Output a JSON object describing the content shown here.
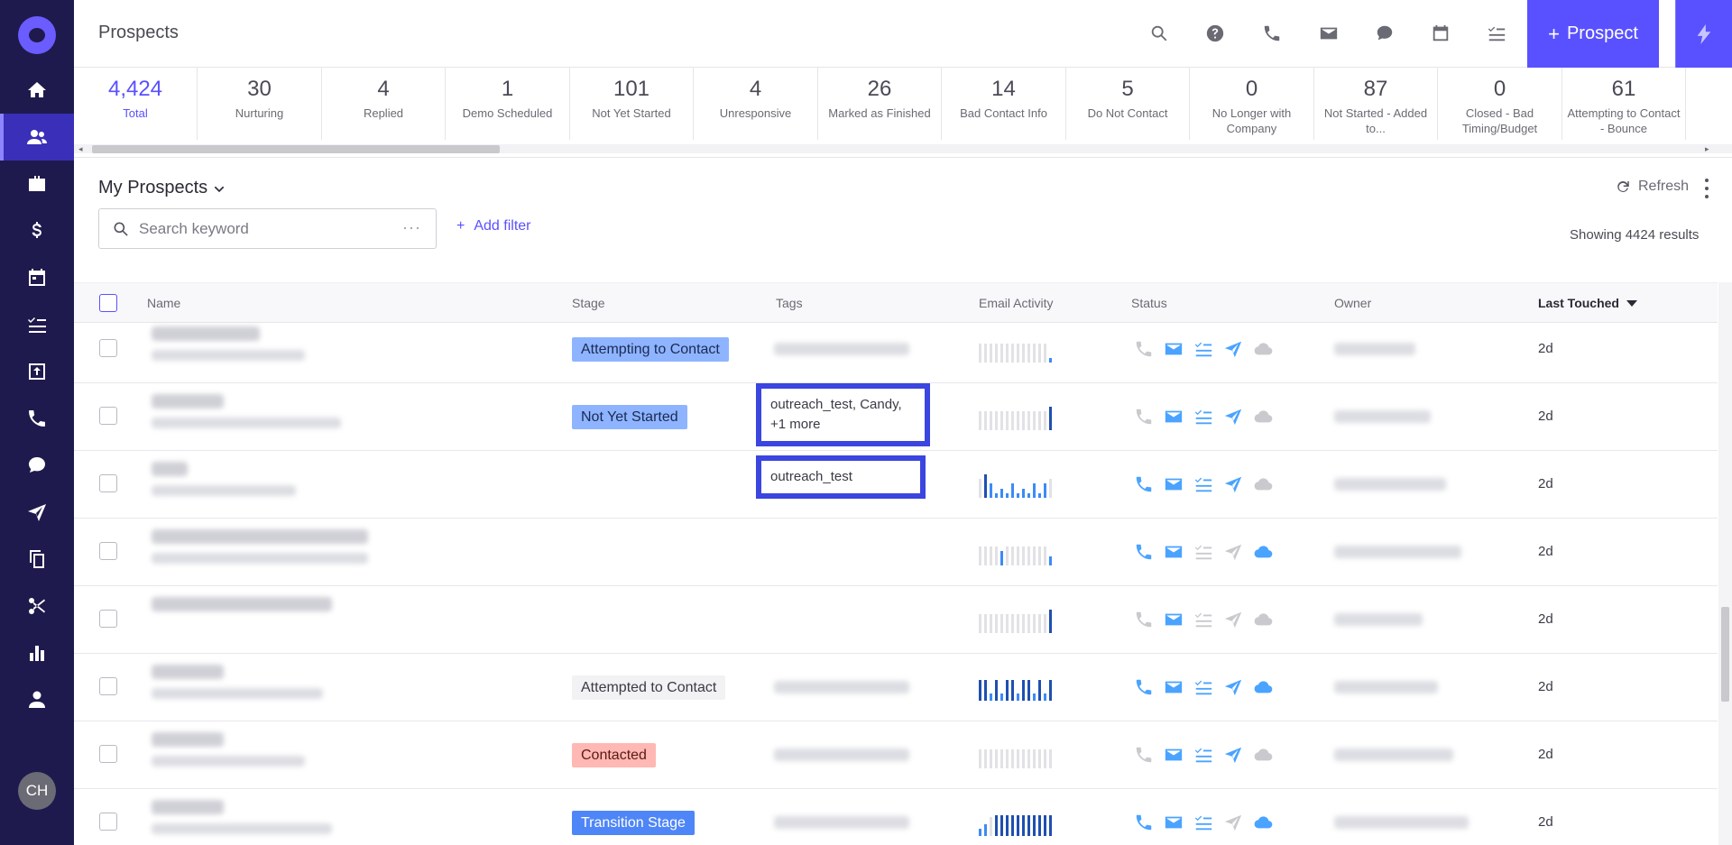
{
  "header": {
    "title": "Prospects",
    "add_label": "Prospect"
  },
  "stages": [
    {
      "count": "4,424",
      "label": "Total",
      "selected": true
    },
    {
      "count": "30",
      "label": "Nurturing"
    },
    {
      "count": "4",
      "label": "Replied"
    },
    {
      "count": "1",
      "label": "Demo Scheduled"
    },
    {
      "count": "101",
      "label": "Not Yet Started"
    },
    {
      "count": "4",
      "label": "Unresponsive"
    },
    {
      "count": "26",
      "label": "Marked as Finished"
    },
    {
      "count": "14",
      "label": "Bad Contact Info"
    },
    {
      "count": "5",
      "label": "Do Not Contact"
    },
    {
      "count": "0",
      "label": "No Longer with Company"
    },
    {
      "count": "87",
      "label": "Not Started - Added to..."
    },
    {
      "count": "0",
      "label": "Closed - Bad Timing/Budget"
    },
    {
      "count": "61",
      "label": "Attempting to Contact - Bounce"
    }
  ],
  "list": {
    "title": "My Prospects",
    "search_placeholder": "Search keyword",
    "add_filter": "Add filter",
    "refresh": "Refresh",
    "results": "Showing 4424 results"
  },
  "table": {
    "columns": {
      "name": "Name",
      "stage": "Stage",
      "tags": "Tags",
      "email_activity": "Email Activity",
      "status": "Status",
      "owner": "Owner",
      "last_touched": "Last Touched"
    },
    "rows": [
      {
        "stage": "Attempting to Contact",
        "stage_style": "blue-light",
        "tags": "",
        "tags_blur": true,
        "last_touched": "2d",
        "bars": [
          0.8,
          0.8,
          0.8,
          0.8,
          0.8,
          0.8,
          0.8,
          0.8,
          0.8,
          0.8,
          0.8,
          0.8,
          0.8,
          0.2
        ],
        "status": {
          "phone": false,
          "mail": true,
          "tasks": true,
          "send": true,
          "cloud": "gray"
        }
      },
      {
        "stage": "Not Yet Started",
        "stage_style": "blue-light",
        "tags": "outreach_test,  Candy,\n+1 more",
        "tags_boxed": true,
        "last_touched": "2d",
        "bars": [
          0.8,
          0.8,
          0.8,
          0.8,
          0.8,
          0.8,
          0.8,
          0.8,
          0.8,
          0.8,
          0.8,
          0.8,
          0.8,
          1.0
        ],
        "status": {
          "phone": false,
          "mail": true,
          "tasks": true,
          "send": true,
          "cloud": "gray"
        }
      },
      {
        "stage": "",
        "stage_style": "",
        "tags": "outreach_test",
        "tags_boxed": true,
        "last_touched": "2d",
        "bars": [
          0.8,
          1.0,
          0.6,
          0.2,
          0.4,
          0.2,
          0.6,
          0.2,
          0.4,
          0.2,
          0.6,
          0.2,
          0.6,
          0.8
        ],
        "status": {
          "phone": true,
          "mail": true,
          "tasks": true,
          "send": true,
          "cloud": "gray"
        }
      },
      {
        "stage": "",
        "stage_style": "",
        "tags": "",
        "last_touched": "2d",
        "bars": [
          0.8,
          0.8,
          0.8,
          0.8,
          0.6,
          0.8,
          0.8,
          0.8,
          0.8,
          0.8,
          0.8,
          0.8,
          0.8,
          0.4
        ],
        "status": {
          "phone": true,
          "mail": true,
          "tasks": false,
          "send": false,
          "cloud": "blue"
        }
      },
      {
        "stage": "",
        "stage_style": "",
        "tags": "",
        "last_touched": "2d",
        "bars": [
          0.8,
          0.8,
          0.8,
          0.8,
          0.8,
          0.8,
          0.8,
          0.8,
          0.8,
          0.8,
          0.8,
          0.8,
          0.8,
          1.0
        ],
        "status": {
          "phone": false,
          "mail": true,
          "tasks": false,
          "send": false,
          "cloud": "gray"
        }
      },
      {
        "stage": "Attempted to Contact",
        "stage_style": "gray",
        "tags": "",
        "tags_blur": true,
        "last_touched": "2d",
        "bars": [
          0.9,
          0.9,
          0.3,
          0.9,
          0.3,
          0.9,
          0.9,
          0.3,
          0.9,
          0.9,
          0.3,
          0.9,
          0.3,
          0.9
        ],
        "status": {
          "phone": true,
          "mail": true,
          "tasks": true,
          "send": true,
          "cloud": "blue"
        }
      },
      {
        "stage": "Contacted",
        "stage_style": "red",
        "tags": "",
        "tags_blur": true,
        "last_touched": "2d",
        "bars": [
          0.8,
          0.8,
          0.8,
          0.8,
          0.8,
          0.8,
          0.8,
          0.8,
          0.8,
          0.8,
          0.8,
          0.8,
          0.8,
          0.8
        ],
        "status": {
          "phone": false,
          "mail": true,
          "tasks": true,
          "send": true,
          "cloud": "gray"
        }
      },
      {
        "stage": "Transition Stage",
        "stage_style": "blue-dark",
        "tags": "",
        "tags_blur": true,
        "last_touched": "2d",
        "bars": [
          0.3,
          0.5,
          0.8,
          0.9,
          0.9,
          0.9,
          0.9,
          0.9,
          0.9,
          0.9,
          0.9,
          0.9,
          0.9,
          0.9
        ],
        "status": {
          "phone": true,
          "mail": true,
          "tasks": true,
          "send": false,
          "cloud": "blue"
        }
      }
    ]
  },
  "user": {
    "initials": "CH"
  },
  "colors": {
    "accent": "#5951ff",
    "rail": "#1f1a4d",
    "icon_blue": "#4aa3ff"
  }
}
